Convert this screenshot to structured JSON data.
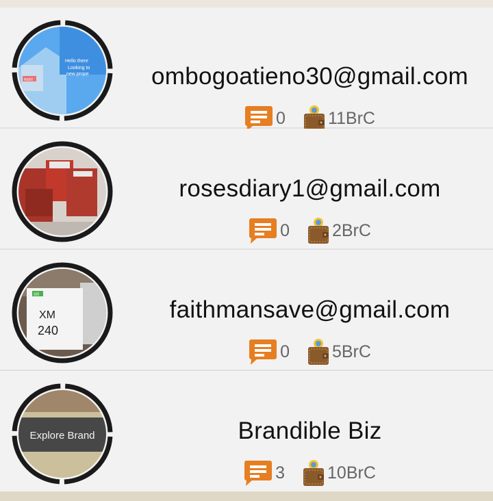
{
  "users": [
    {
      "title": "ombogoatieno30@gmail.com",
      "comments": "0",
      "balance": "11BrC",
      "avatar": "property-flyer-image",
      "avatar_text": [
        "Hello there",
        "Looking to",
        "new prope",
        "RENT"
      ]
    },
    {
      "title": "rosesdiary1@gmail.com",
      "comments": "0",
      "balance": "2BrC",
      "avatar": "snack-packets-image"
    },
    {
      "title": "faithmansave@gmail.com",
      "comments": "0",
      "balance": "5BrC",
      "avatar": "phone-box-image",
      "avatar_text": [
        "XR",
        "XM",
        "240"
      ]
    },
    {
      "title": "Brandible Biz",
      "comments": "3",
      "balance": "10BrC",
      "avatar": "explore-brand-image",
      "avatar_text": [
        "Explore Brand"
      ]
    }
  ],
  "colors": {
    "comment_icon": "#e67e22",
    "wallet": "#8b5a2b",
    "ring": "#1a1a1a"
  },
  "icons": {
    "comments": "comment-bubble-icon",
    "wallet": "wallet-icon"
  }
}
